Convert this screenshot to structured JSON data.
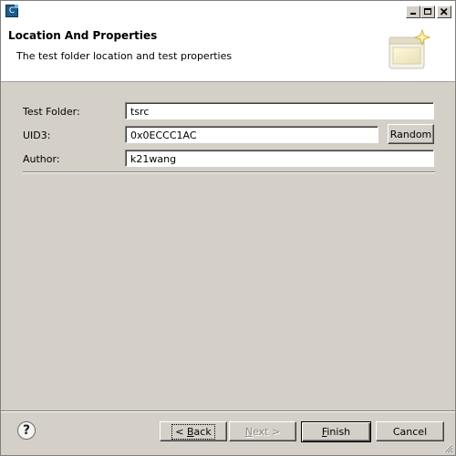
{
  "window": {
    "app_icon": "C",
    "icons": {
      "app": "c-file-icon",
      "minimize": "minimize-icon",
      "maximize": "maximize-icon",
      "close": "close-icon"
    }
  },
  "header": {
    "title": "Location And Properties",
    "description": "The test folder location and test properties",
    "banner_icon": "wizard-sparkle-icon"
  },
  "form": {
    "test_folder": {
      "label": "Test Folder:",
      "value": "tsrc"
    },
    "uid3": {
      "label": "UID3:",
      "value": "0x0ECCC1AC",
      "random_label": "Random"
    },
    "author": {
      "label": "Author:",
      "value": "k21wang"
    }
  },
  "footer": {
    "help_icon": "help-icon",
    "help_glyph": "?",
    "back_prefix": "< ",
    "back_mnemonic": "B",
    "back_rest": "ack",
    "next_mnemonic": "N",
    "next_rest": "ext >",
    "finish_mnemonic": "F",
    "finish_rest": "inish",
    "cancel_label": "Cancel"
  },
  "colors": {
    "dialog_bg": "#d4d0c8",
    "header_bg": "#ffffff",
    "app_icon": "#1e5c8c",
    "disabled_text": "#8c8a84"
  }
}
